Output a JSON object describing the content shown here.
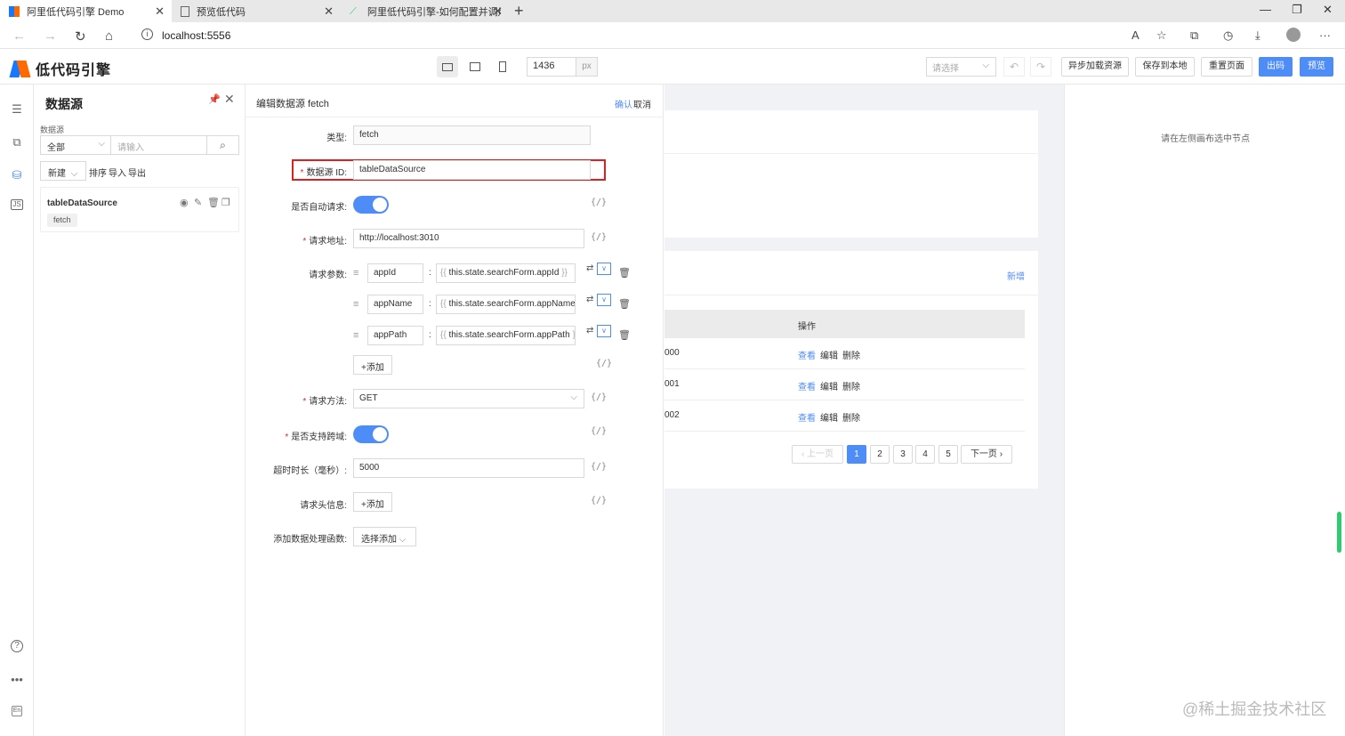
{
  "browser": {
    "tabs": [
      {
        "label": "阿里低代码引擎 Demo",
        "active": true
      },
      {
        "label": "预览低代码",
        "active": false
      },
      {
        "label": "阿里低代码引擎-如何配置并调用",
        "active": false
      }
    ],
    "url": "localhost:5556"
  },
  "app": {
    "logo_text": "低代码引擎",
    "canvas_width": "1436",
    "width_unit": "px",
    "select_placeholder": "请选择",
    "buttons": {
      "async_load": "异步加载资源",
      "save_local": "保存到本地",
      "reset_page": "重置页面",
      "export": "出码",
      "preview": "预览"
    }
  },
  "datasource_panel": {
    "title": "数据源",
    "filter_label": "数据源",
    "filter_value": "全部",
    "search_placeholder": "请输入",
    "new_label": "新建",
    "links": [
      "排序",
      "导入",
      "导出"
    ],
    "items": [
      {
        "name": "tableDataSource",
        "type": "fetch"
      }
    ]
  },
  "edit_panel": {
    "title": "编辑数据源 fetch",
    "confirm": "确认",
    "cancel": "取消",
    "fields": {
      "type_label": "类型:",
      "type_value": "fetch",
      "id_label": "数据源 ID:",
      "id_value": "tableDataSource",
      "auto_label": "是否自动请求:",
      "url_label": "请求地址:",
      "url_value": "http://localhost:3010",
      "params_label": "请求参数:",
      "params": [
        {
          "key": "appId",
          "value": "this.state.searchForm.appId"
        },
        {
          "key": "appName",
          "value": "this.state.searchForm.appName"
        },
        {
          "key": "appPath",
          "value": "this.state.searchForm.appPath"
        }
      ],
      "add_label": "+添加",
      "method_label": "请求方法:",
      "method_value": "GET",
      "cors_label": "是否支持跨域:",
      "timeout_label": "超时时长（毫秒）:",
      "timeout_value": "5000",
      "headers_label": "请求头信息:",
      "handler_label": "添加数据处理函数:",
      "handler_select": "选择添加"
    },
    "var_expr": "{/}",
    "expr_open": "{{",
    "expr_close": "}}"
  },
  "canvas": {
    "add_link": "新增",
    "table_header_action": "操作",
    "rows": [
      {
        "id": "000",
        "view": "查看",
        "edit": "编辑",
        "delete": "删除"
      },
      {
        "id": "001",
        "view": "查看",
        "edit": "编辑",
        "delete": "删除"
      },
      {
        "id": "002",
        "view": "查看",
        "edit": "编辑",
        "delete": "删除"
      }
    ],
    "pager": {
      "prev": "上一页",
      "pages": [
        "1",
        "2",
        "3",
        "4",
        "5"
      ],
      "current": "1",
      "next": "下一页"
    }
  },
  "right_panel": {
    "hint": "请在左侧画布选中节点",
    "watermark": "@稀土掘金技术社区"
  },
  "colors": {
    "primary": "#4e8cf7",
    "required": "#f5222d",
    "highlight": "#e02020"
  }
}
